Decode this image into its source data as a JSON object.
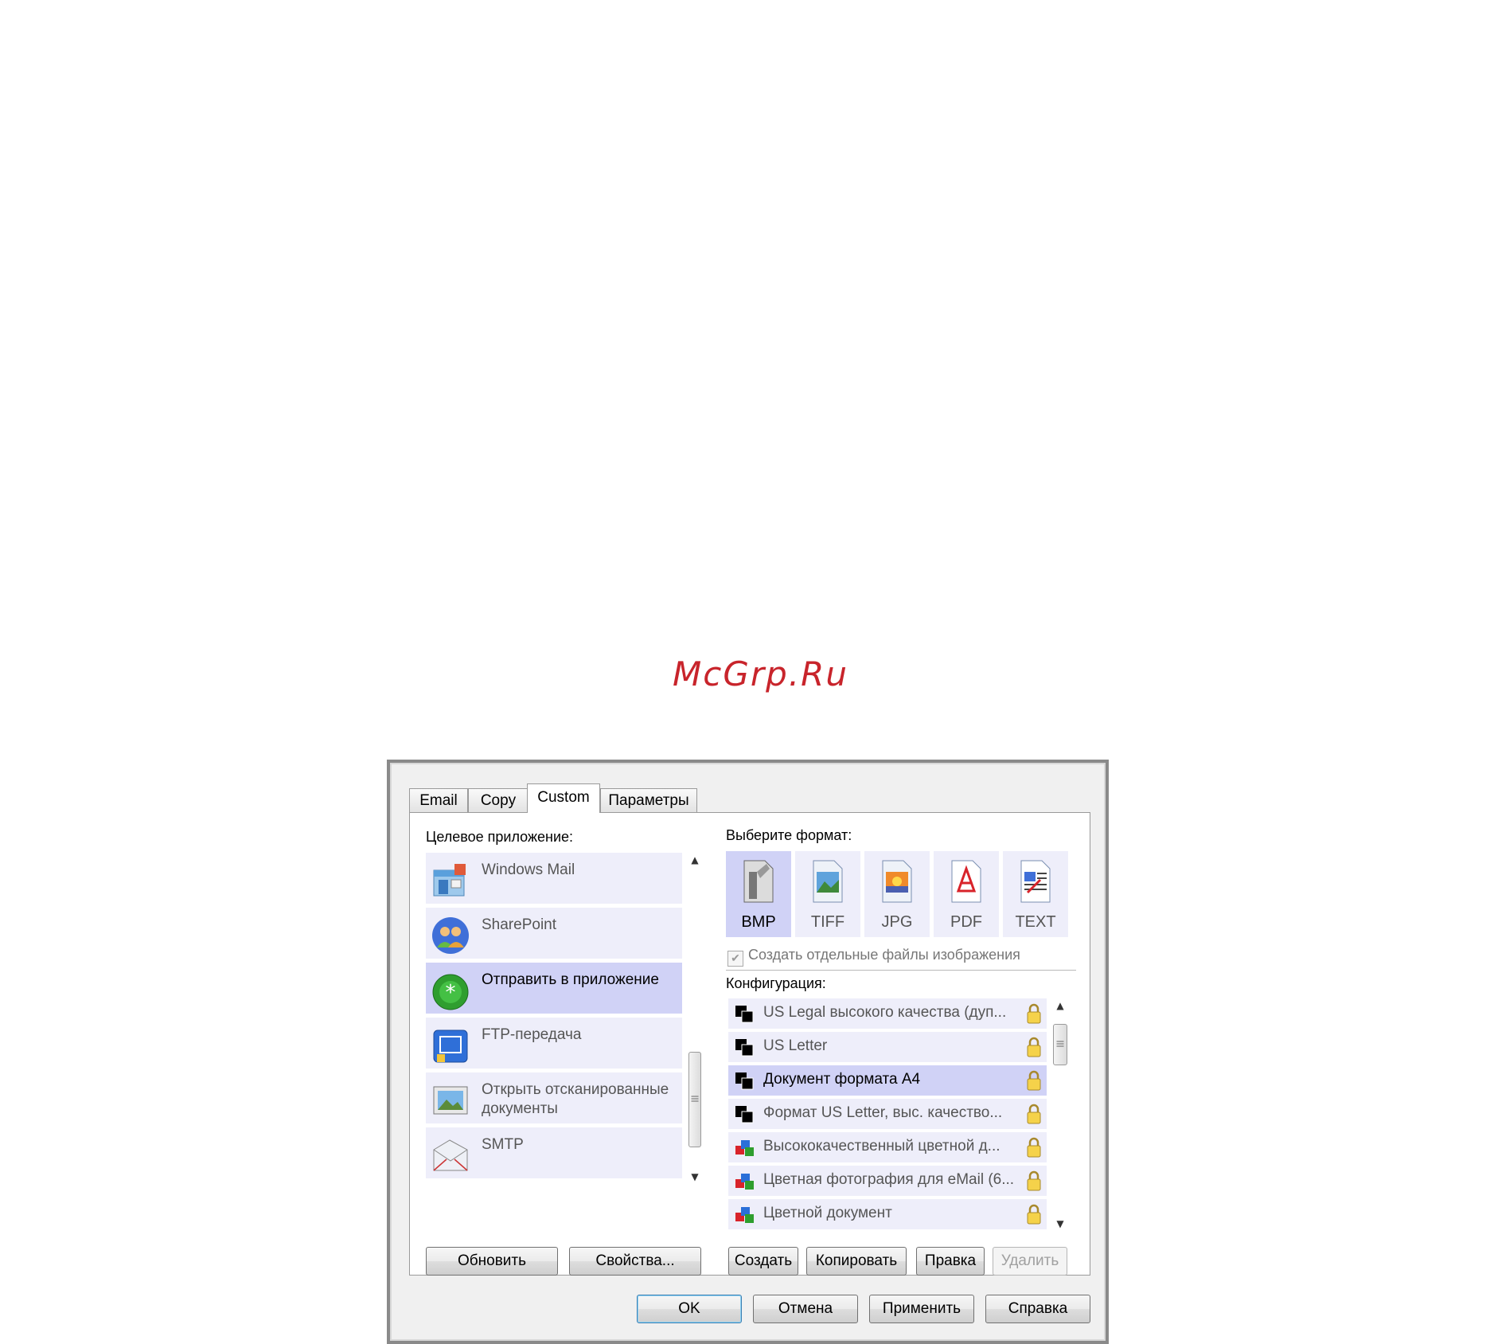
{
  "watermark": "McGrp.Ru",
  "tabs": [
    {
      "label": "Email"
    },
    {
      "label": "Copy"
    },
    {
      "label": "Custom"
    },
    {
      "label": "Параметры"
    }
  ],
  "left": {
    "label": "Целевое приложение:",
    "apps": [
      {
        "label": "Windows Mail",
        "icon": "windows-mail-icon"
      },
      {
        "label": "SharePoint",
        "icon": "sharepoint-icon"
      },
      {
        "label": "Отправить в приложение",
        "icon": "send-to-app-icon"
      },
      {
        "label": "FTP-передача",
        "icon": "ftp-icon"
      },
      {
        "label": "Открыть отсканированные документы",
        "icon": "open-scanned-icon"
      },
      {
        "label": "SMTP",
        "icon": "smtp-icon"
      }
    ],
    "selected_app": "Отправить в приложение",
    "buttons": {
      "refresh": "Обновить",
      "properties": "Свойства..."
    }
  },
  "right": {
    "format_label": "Выберите формат:",
    "formats": [
      {
        "label": "BMP"
      },
      {
        "label": "TIFF"
      },
      {
        "label": "JPG"
      },
      {
        "label": "PDF"
      },
      {
        "label": "TEXT"
      }
    ],
    "selected_format": "BMP",
    "separate_files": {
      "label": "Создать отдельные файлы изображения",
      "checked": true,
      "enabled": false
    },
    "config_label": "Конфигурация:",
    "configs": [
      {
        "label": "US Legal высокого качества (дуп...",
        "type": "bw",
        "locked": true
      },
      {
        "label": "US Letter",
        "type": "bw",
        "locked": true
      },
      {
        "label": "Документ формата A4",
        "type": "bw",
        "locked": true
      },
      {
        "label": "Формат US Letter, выс. качество...",
        "type": "bw",
        "locked": true
      },
      {
        "label": "Высококачественный цветной д...",
        "type": "color",
        "locked": true
      },
      {
        "label": "Цветная фотография для eMail (6...",
        "type": "color",
        "locked": true
      },
      {
        "label": "Цветной документ",
        "type": "color",
        "locked": true
      }
    ],
    "selected_config": "Документ формата A4",
    "buttons": {
      "create": "Создать",
      "copy": "Копировать",
      "edit": "Правка",
      "delete": "Удалить"
    }
  },
  "footer": {
    "ok": "OK",
    "cancel": "Отмена",
    "apply": "Применить",
    "help": "Справка"
  },
  "colors": {
    "selected_bg": "#d0d2f6",
    "item_bg": "#eeeefa",
    "watermark": "#c8242b"
  }
}
